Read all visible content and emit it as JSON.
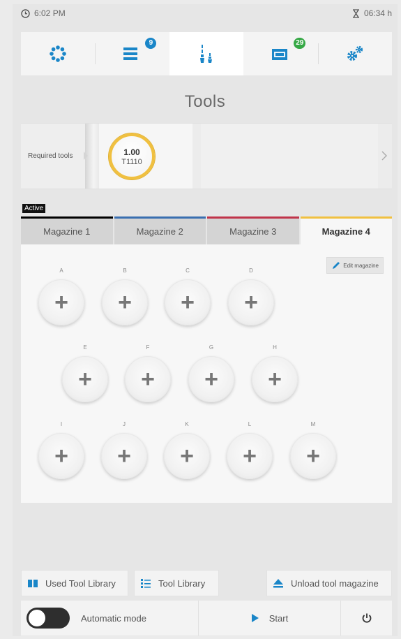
{
  "status": {
    "clock": "6:02 PM",
    "timer": "06:34 h"
  },
  "nav": {
    "items": [
      {
        "name": "machine",
        "badge": ""
      },
      {
        "name": "jobs",
        "badge": "9"
      },
      {
        "name": "tools",
        "badge": ""
      },
      {
        "name": "materials",
        "badge": "29"
      },
      {
        "name": "settings",
        "badge": ""
      }
    ],
    "active_index": 2
  },
  "page": {
    "title": "Tools"
  },
  "required_tools": {
    "label": "Required tools",
    "tool": {
      "value": "1.00",
      "id": "T1110"
    }
  },
  "active_label": "Active",
  "magazines": {
    "tabs": [
      {
        "label": "Magazine 1",
        "color": "#000000"
      },
      {
        "label": "Magazine 2",
        "color": "#3a6fb0"
      },
      {
        "label": "Magazine 3",
        "color": "#c0344a"
      },
      {
        "label": "Magazine 4",
        "color": "#f0c040"
      }
    ],
    "selected": "Magazine 4",
    "edit_label": "Edit magazine",
    "slots": [
      {
        "label": "A",
        "symbol": "+"
      },
      {
        "label": "B",
        "symbol": "+"
      },
      {
        "label": "C",
        "symbol": "+"
      },
      {
        "label": "D",
        "symbol": "+"
      },
      {
        "label": "E",
        "symbol": "+"
      },
      {
        "label": "F",
        "symbol": "+"
      },
      {
        "label": "G",
        "symbol": "+"
      },
      {
        "label": "H",
        "symbol": "+"
      },
      {
        "label": "I",
        "symbol": "+"
      },
      {
        "label": "J",
        "symbol": "+"
      },
      {
        "label": "K",
        "symbol": "+"
      },
      {
        "label": "L",
        "symbol": "+"
      },
      {
        "label": "M",
        "symbol": "+"
      }
    ]
  },
  "actions": {
    "used_tool_library": "Used Tool Library",
    "tool_library": "Tool Library",
    "unload_magazine": "Unload tool magazine"
  },
  "bottom": {
    "automatic_mode": "Automatic mode",
    "start": "Start"
  },
  "colors": {
    "accent": "#1a86c8",
    "badge_blue": "#1a86c8",
    "badge_green": "#35a845",
    "tool_ring": "#f0c040"
  }
}
